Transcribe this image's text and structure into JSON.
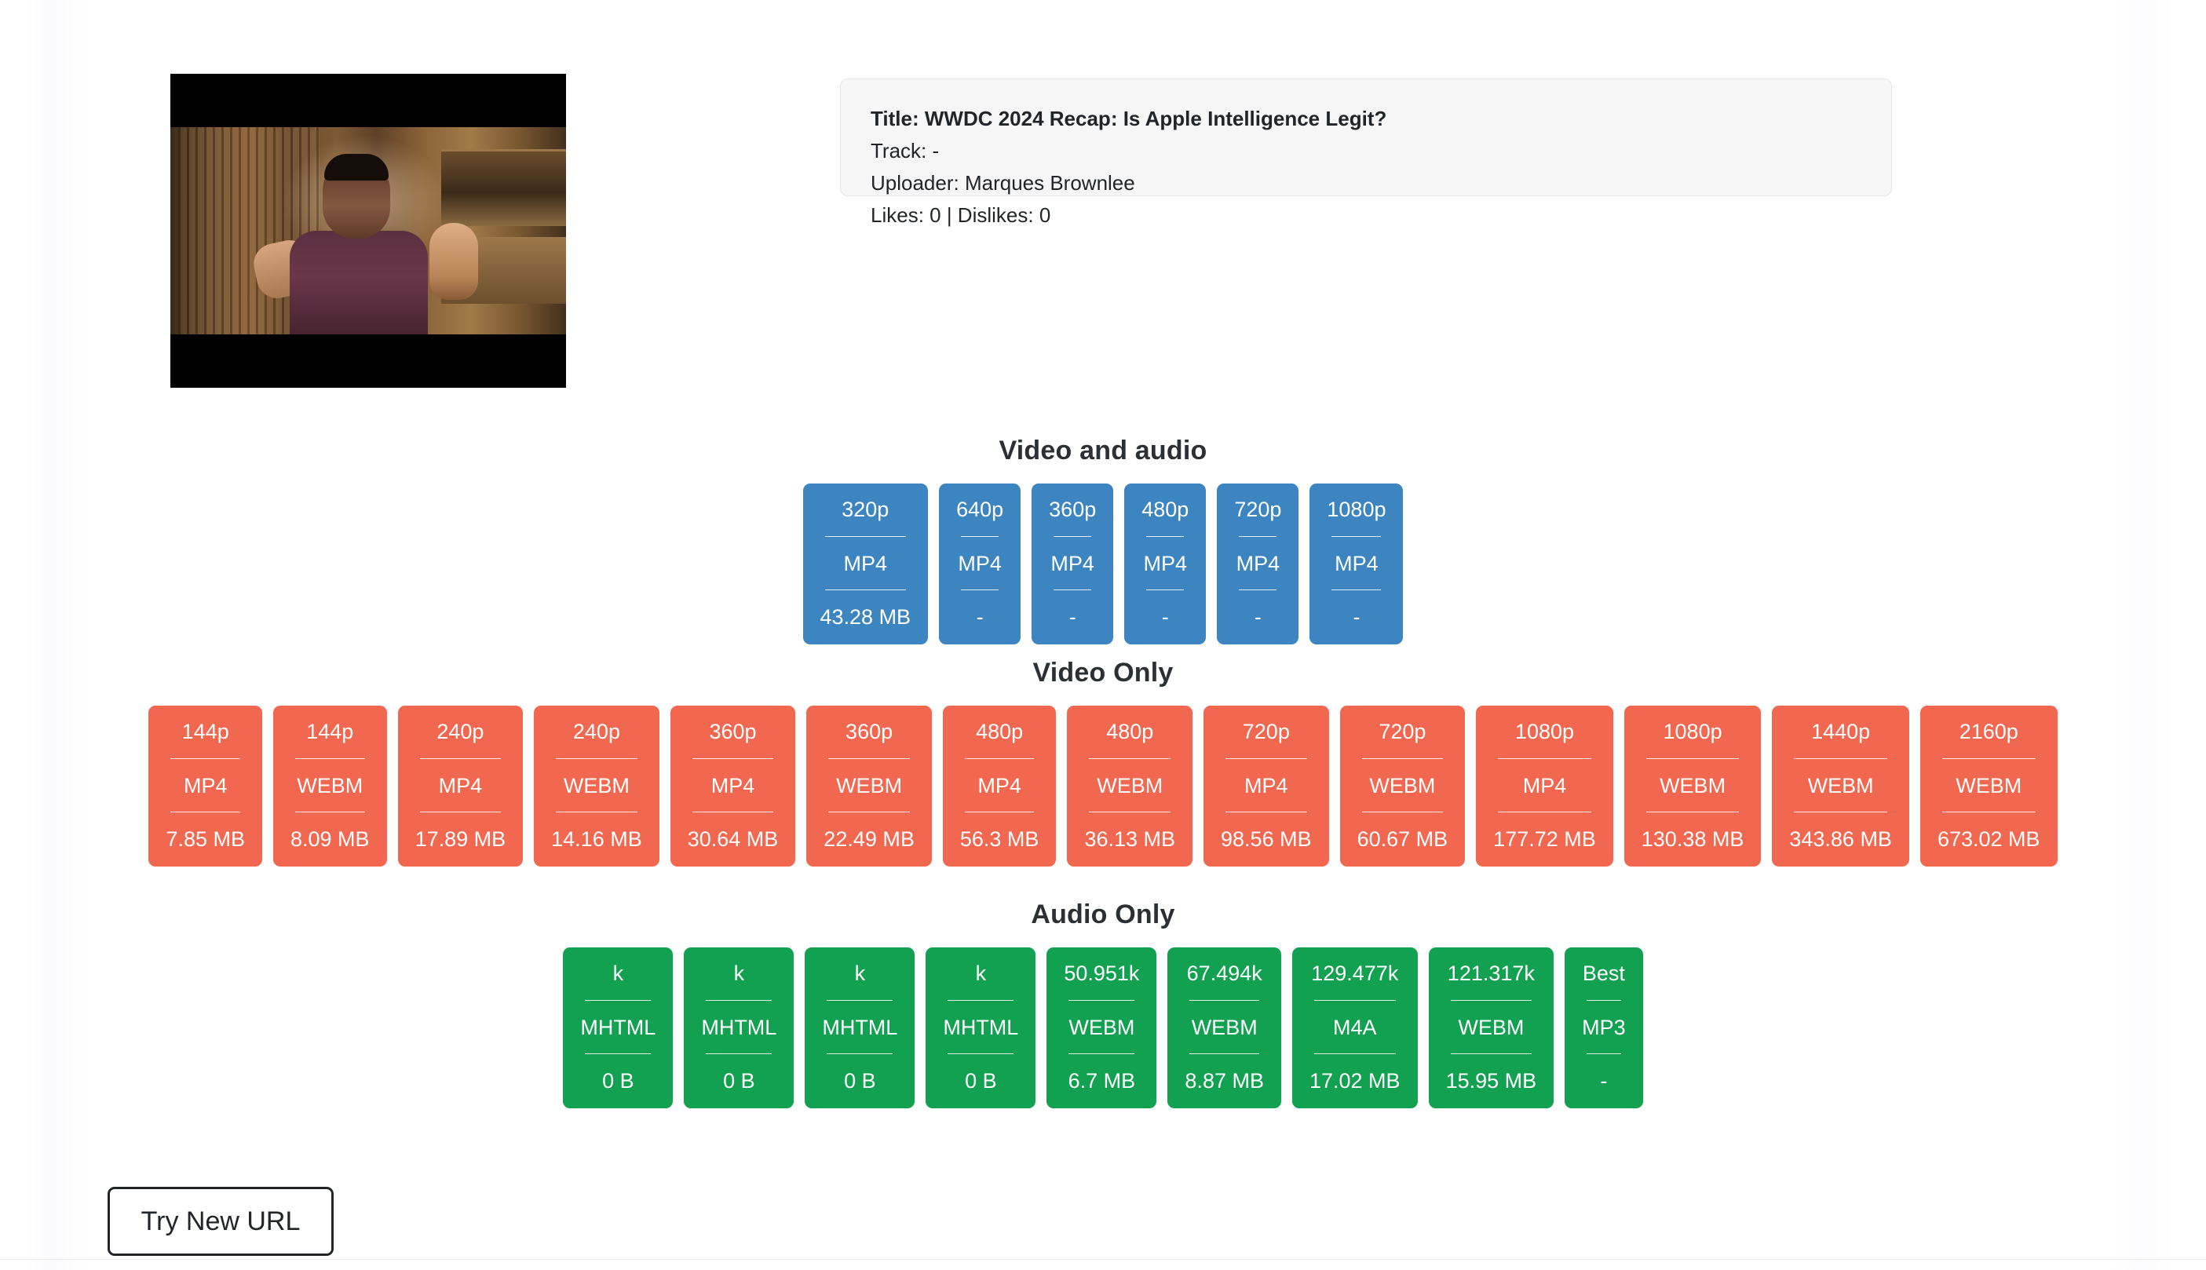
{
  "video_info": {
    "title_line": "Title: WWDC 2024 Recap: Is Apple Intelligence Legit?",
    "track_line": "Track: -",
    "uploader_line": "Uploader: Marques Brownlee",
    "likes_line": "Likes: 0 | Dislikes: 0"
  },
  "thumbnail": {
    "alt": "video-thumbnail"
  },
  "colors": {
    "video_and_audio": "#3d85c0",
    "video_only": "#f2674f",
    "audio_only": "#12a150",
    "text_dark": "#212529",
    "info_card_bg": "#f6f6f6"
  },
  "sections": [
    {
      "id": "video-and-audio",
      "title": "Video and audio",
      "cards": [
        {
          "quality": "320p",
          "format": "MP4",
          "size": "43.28 MB"
        },
        {
          "quality": "640p",
          "format": "MP4",
          "size": "-"
        },
        {
          "quality": "360p",
          "format": "MP4",
          "size": "-"
        },
        {
          "quality": "480p",
          "format": "MP4",
          "size": "-"
        },
        {
          "quality": "720p",
          "format": "MP4",
          "size": "-"
        },
        {
          "quality": "1080p",
          "format": "MP4",
          "size": "-"
        }
      ]
    },
    {
      "id": "video-only",
      "title": "Video Only",
      "cards": [
        {
          "quality": "144p",
          "format": "MP4",
          "size": "7.85 MB"
        },
        {
          "quality": "144p",
          "format": "WEBM",
          "size": "8.09 MB"
        },
        {
          "quality": "240p",
          "format": "MP4",
          "size": "17.89 MB"
        },
        {
          "quality": "240p",
          "format": "WEBM",
          "size": "14.16 MB"
        },
        {
          "quality": "360p",
          "format": "MP4",
          "size": "30.64 MB"
        },
        {
          "quality": "360p",
          "format": "WEBM",
          "size": "22.49 MB"
        },
        {
          "quality": "480p",
          "format": "MP4",
          "size": "56.3 MB"
        },
        {
          "quality": "480p",
          "format": "WEBM",
          "size": "36.13 MB"
        },
        {
          "quality": "720p",
          "format": "MP4",
          "size": "98.56 MB"
        },
        {
          "quality": "720p",
          "format": "WEBM",
          "size": "60.67 MB"
        },
        {
          "quality": "1080p",
          "format": "MP4",
          "size": "177.72 MB"
        },
        {
          "quality": "1080p",
          "format": "WEBM",
          "size": "130.38 MB"
        },
        {
          "quality": "1440p",
          "format": "WEBM",
          "size": "343.86 MB"
        },
        {
          "quality": "2160p",
          "format": "WEBM",
          "size": "673.02 MB"
        }
      ]
    },
    {
      "id": "audio-only",
      "title": "Audio Only",
      "cards": [
        {
          "quality": "k",
          "format": "MHTML",
          "size": "0 B"
        },
        {
          "quality": "k",
          "format": "MHTML",
          "size": "0 B"
        },
        {
          "quality": "k",
          "format": "MHTML",
          "size": "0 B"
        },
        {
          "quality": "k",
          "format": "MHTML",
          "size": "0 B"
        },
        {
          "quality": "50.951k",
          "format": "WEBM",
          "size": "6.7 MB"
        },
        {
          "quality": "67.494k",
          "format": "WEBM",
          "size": "8.87 MB"
        },
        {
          "quality": "129.477k",
          "format": "M4A",
          "size": "17.02 MB"
        },
        {
          "quality": "121.317k",
          "format": "WEBM",
          "size": "15.95 MB"
        },
        {
          "quality": "Best",
          "format": "MP3",
          "size": "-"
        }
      ]
    }
  ],
  "footer": {
    "try_new_url_label": "Try New URL"
  }
}
